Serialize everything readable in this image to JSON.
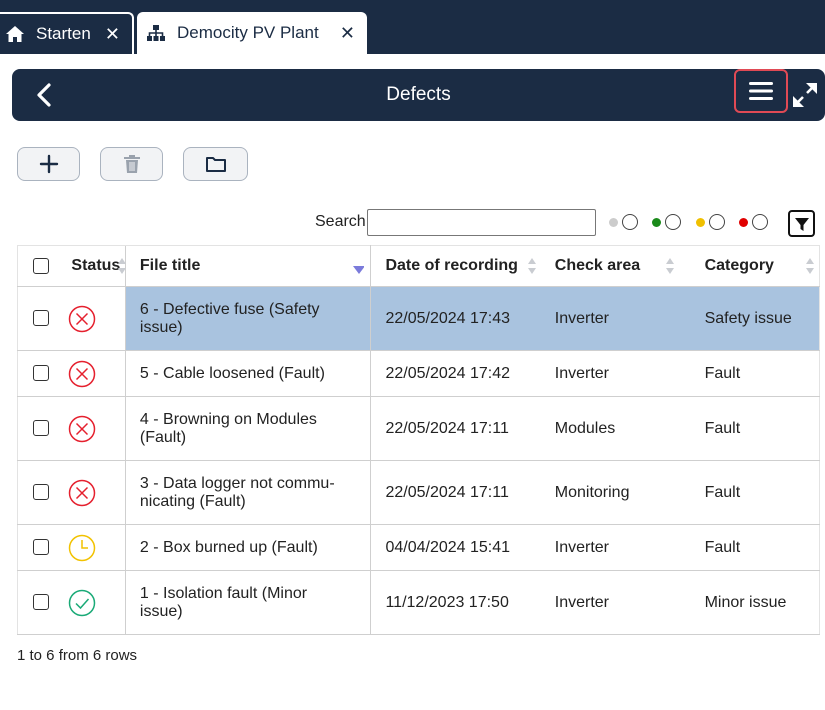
{
  "tabs": [
    {
      "label": "Starten",
      "icon": "home-icon",
      "close": "✕"
    },
    {
      "label": "Democity PV Plant",
      "icon": "sitemap-icon",
      "close": "✕"
    }
  ],
  "header": {
    "title": "Defects",
    "bg": "#1b2c44",
    "menu_highlight": "#e04a55"
  },
  "toolbar": {
    "add_icon": "plus-icon",
    "delete_icon": "trash-icon",
    "folder_icon": "folder-icon"
  },
  "search": {
    "label": "Search",
    "value": "",
    "placeholder": ""
  },
  "status_filters": [
    {
      "name": "none",
      "color": "#cccccc"
    },
    {
      "name": "ok",
      "color": "#1a8a1a"
    },
    {
      "name": "pending",
      "color": "#f0c000"
    },
    {
      "name": "defect",
      "color": "#e00000"
    }
  ],
  "table": {
    "columns": {
      "status": "Status",
      "title": "File title",
      "date": "Date of recording",
      "area": "Check area",
      "category": "Category"
    },
    "rows": [
      {
        "status": "error",
        "title_1": "6 - Defective fuse (Safety",
        "title_2": "issue)",
        "date": "22/05/2024 17:43",
        "area": "Inverter",
        "category": "Safety issue",
        "selected": true
      },
      {
        "status": "error",
        "title_1": "5 - Cable loosened (Fault)",
        "title_2": "",
        "date": "22/05/2024 17:42",
        "area": "Inverter",
        "category": "Fault",
        "selected": false
      },
      {
        "status": "error",
        "title_1": "4 - Browning on Modules",
        "title_2": "(Fault)",
        "date": "22/05/2024 17:11",
        "area": "Modules",
        "category": "Fault",
        "selected": false
      },
      {
        "status": "error",
        "title_1": "3 - Data logger not commu-",
        "title_2": "nicating (Fault)",
        "date": "22/05/2024 17:11",
        "area": "Monitoring",
        "category": "Fault",
        "selected": false
      },
      {
        "status": "pending",
        "title_1": "2 - Box burned up (Fault)",
        "title_2": "",
        "date": "04/04/2024 15:41",
        "area": "Inverter",
        "category": "Fault",
        "selected": false
      },
      {
        "status": "ok",
        "title_1": "1 - Isolation fault (Minor",
        "title_2": "issue)",
        "date": "11/12/2023 17:50",
        "area": "Inverter",
        "category": "Minor issue",
        "selected": false
      }
    ]
  },
  "footer": {
    "text": "1 to 6 from 6 rows"
  },
  "colors": {
    "error": "#e5202e",
    "pending": "#f2c200",
    "ok": "#1aaa77",
    "selected_row": "#a9c3df"
  }
}
